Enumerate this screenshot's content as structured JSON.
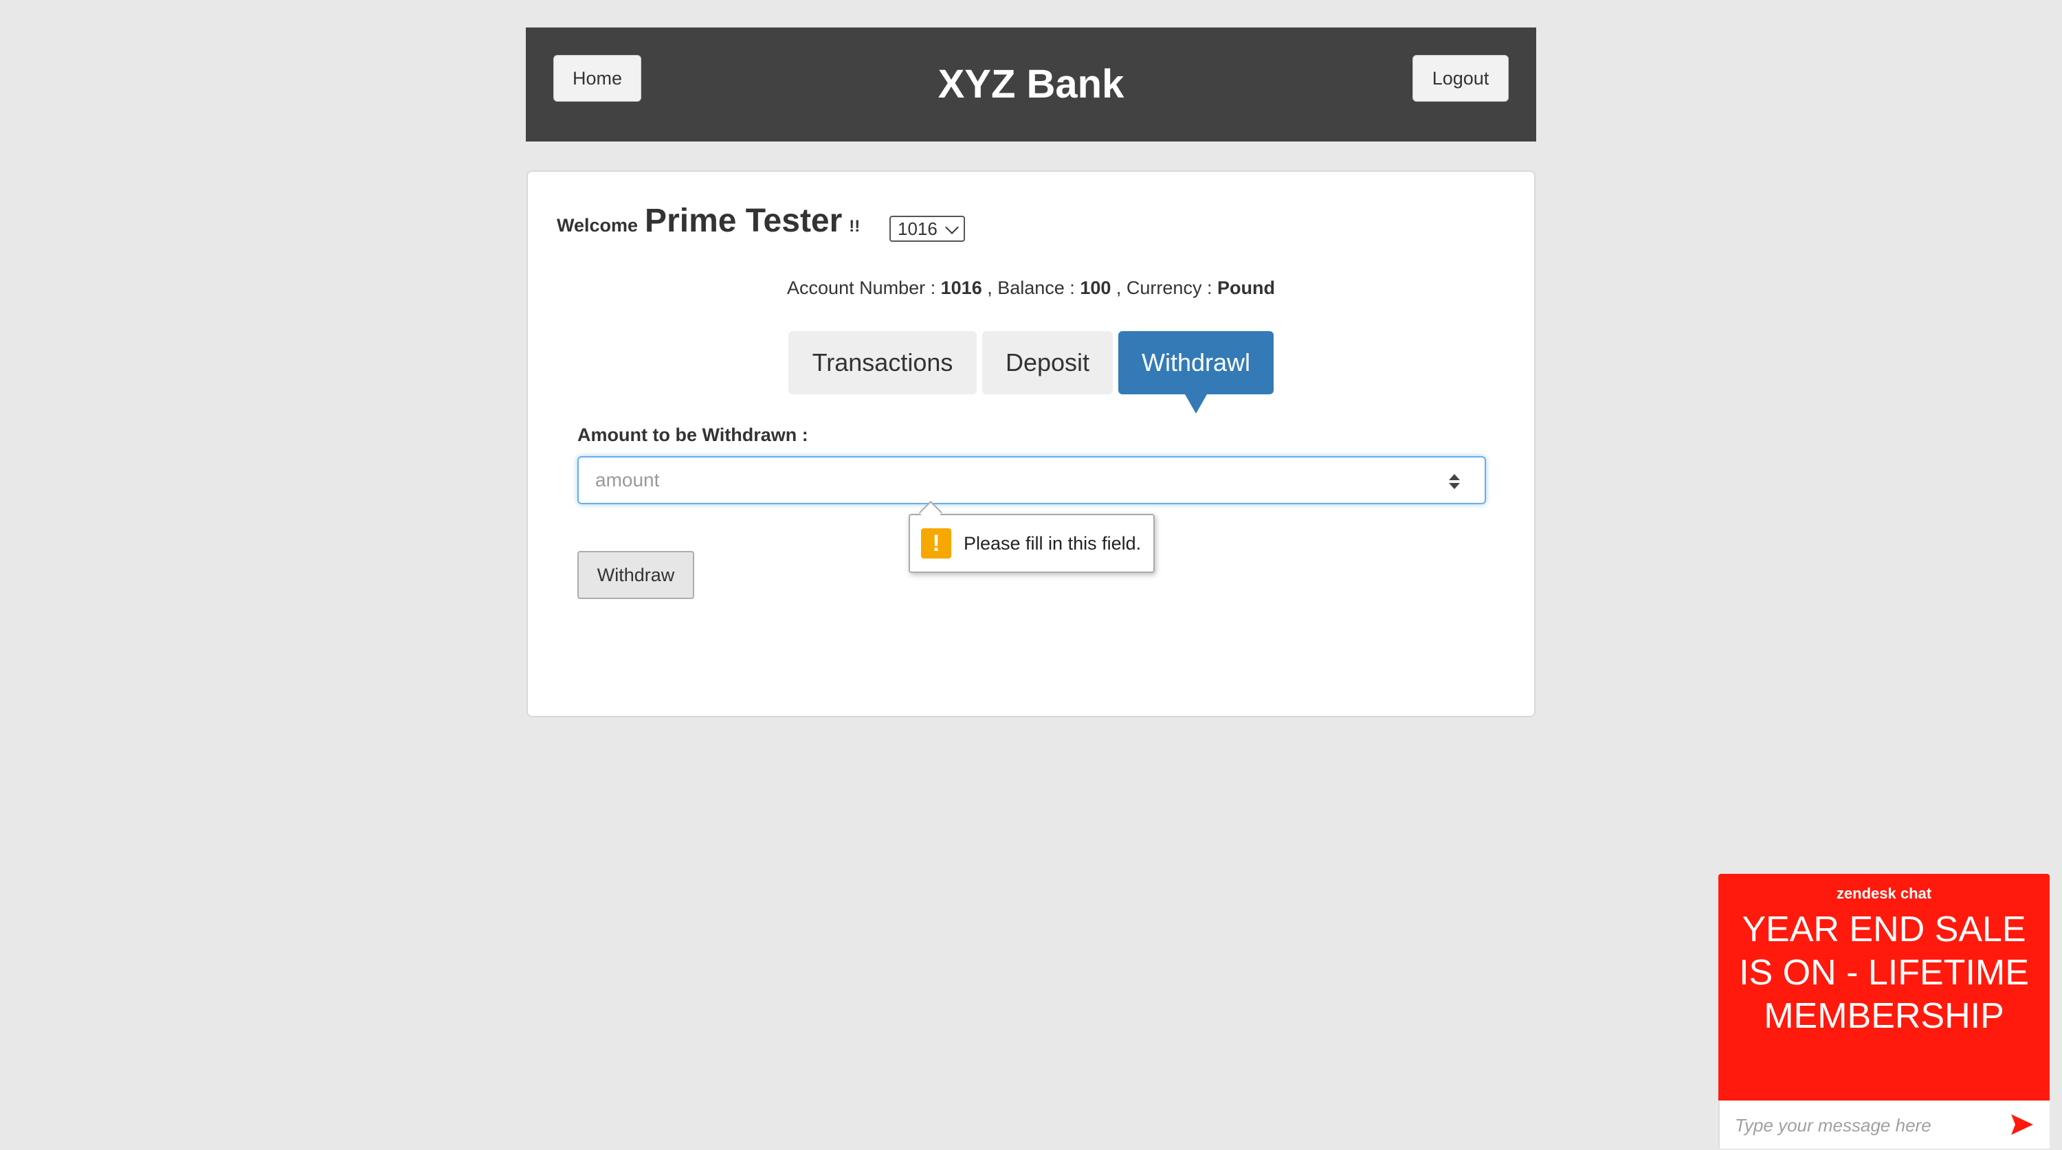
{
  "header": {
    "home_label": "Home",
    "title": "XYZ Bank",
    "logout_label": "Logout"
  },
  "welcome": {
    "greeting": "Welcome",
    "user_name": "Prime Tester",
    "suffix": "!!",
    "selected_account": "1016"
  },
  "account_info": {
    "number_label": "Account Number :",
    "number": "1016",
    "balance_label": ", Balance :",
    "balance": "100",
    "currency_label": ", Currency :",
    "currency": "Pound"
  },
  "tabs": [
    {
      "label": "Transactions",
      "active": false
    },
    {
      "label": "Deposit",
      "active": false
    },
    {
      "label": "Withdrawl",
      "active": true
    }
  ],
  "form": {
    "amount_label": "Amount to be Withdrawn :",
    "amount_placeholder": "amount",
    "amount_value": "",
    "validation_message": "Please fill in this field.",
    "submit_label": "Withdraw"
  },
  "chat": {
    "brand": "zendesk chat",
    "message": "YEAR END SALE IS ON - LIFETIME MEMBERSHIP",
    "input_placeholder": "Type your message here"
  },
  "colors": {
    "header_bg": "#424242",
    "active_tab": "#337ab7",
    "warning": "#f7a800",
    "chat_bg": "#ff1a0d"
  }
}
